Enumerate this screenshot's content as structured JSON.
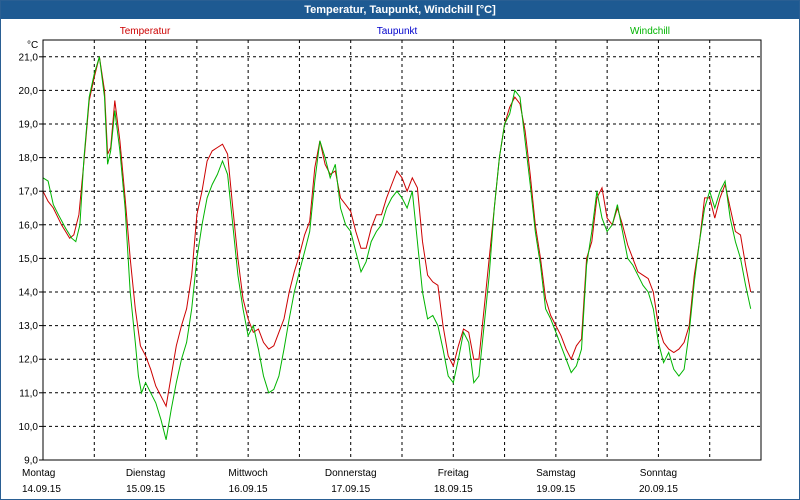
{
  "title": "Temperatur, Taupunkt, Windchill [°C]",
  "chart_data": {
    "type": "line",
    "ylabel": "°C",
    "ylim": [
      9.0,
      21.5
    ],
    "yticks": [
      "21,0",
      "20,0",
      "19,0",
      "18,0",
      "17,0",
      "16,0",
      "15,0",
      "14,0",
      "13,0",
      "12,0",
      "11,0",
      "10,0",
      "9,0"
    ],
    "ytick_values": [
      21,
      20,
      19,
      18,
      17,
      16,
      15,
      14,
      13,
      12,
      11,
      10,
      9
    ],
    "xlim": [
      0,
      7
    ],
    "grid": true,
    "days": [
      {
        "day": "Montag",
        "date": "14.09.15"
      },
      {
        "day": "Dienstag",
        "date": "15.09.15"
      },
      {
        "day": "Mittwoch",
        "date": "16.09.15"
      },
      {
        "day": "Donnerstag",
        "date": "17.09.15"
      },
      {
        "day": "Freitag",
        "date": "18.09.15"
      },
      {
        "day": "Samstag",
        "date": "19.09.15"
      },
      {
        "day": "Sonntag",
        "date": "20.09.15"
      }
    ],
    "legend": [
      {
        "name": "Temperatur",
        "color": "#cc0000"
      },
      {
        "name": "Taupunkt",
        "color": "#0000cc"
      },
      {
        "name": "Windchill",
        "color": "#00b400"
      }
    ],
    "series": [
      {
        "name": "Temperatur",
        "color": "#cc0000",
        "points": [
          [
            0.0,
            17.0
          ],
          [
            0.05,
            16.7
          ],
          [
            0.1,
            16.5
          ],
          [
            0.18,
            16.0
          ],
          [
            0.26,
            15.6
          ],
          [
            0.3,
            15.7
          ],
          [
            0.35,
            16.3
          ],
          [
            0.4,
            17.9
          ],
          [
            0.45,
            19.7
          ],
          [
            0.5,
            20.4
          ],
          [
            0.55,
            21.0
          ],
          [
            0.6,
            20.0
          ],
          [
            0.63,
            18.1
          ],
          [
            0.66,
            18.3
          ],
          [
            0.7,
            19.7
          ],
          [
            0.75,
            18.5
          ],
          [
            0.8,
            16.8
          ],
          [
            0.85,
            15.0
          ],
          [
            0.9,
            13.5
          ],
          [
            0.95,
            12.4
          ],
          [
            1.0,
            12.1
          ],
          [
            1.05,
            11.7
          ],
          [
            1.1,
            11.2
          ],
          [
            1.15,
            10.9
          ],
          [
            1.2,
            10.6
          ],
          [
            1.25,
            11.5
          ],
          [
            1.3,
            12.4
          ],
          [
            1.35,
            13.0
          ],
          [
            1.4,
            13.5
          ],
          [
            1.45,
            14.5
          ],
          [
            1.5,
            16.3
          ],
          [
            1.55,
            17.0
          ],
          [
            1.6,
            17.9
          ],
          [
            1.65,
            18.2
          ],
          [
            1.7,
            18.3
          ],
          [
            1.75,
            18.4
          ],
          [
            1.8,
            18.1
          ],
          [
            1.85,
            16.5
          ],
          [
            1.9,
            15.0
          ],
          [
            1.95,
            13.8
          ],
          [
            2.0,
            13.2
          ],
          [
            2.05,
            12.8
          ],
          [
            2.1,
            12.9
          ],
          [
            2.15,
            12.5
          ],
          [
            2.2,
            12.3
          ],
          [
            2.25,
            12.4
          ],
          [
            2.3,
            12.8
          ],
          [
            2.35,
            13.2
          ],
          [
            2.4,
            14.0
          ],
          [
            2.45,
            14.6
          ],
          [
            2.5,
            15.1
          ],
          [
            2.55,
            15.7
          ],
          [
            2.6,
            16.1
          ],
          [
            2.65,
            17.7
          ],
          [
            2.7,
            18.5
          ],
          [
            2.75,
            17.8
          ],
          [
            2.8,
            17.5
          ],
          [
            2.85,
            17.6
          ],
          [
            2.9,
            16.8
          ],
          [
            2.95,
            16.6
          ],
          [
            3.0,
            16.4
          ],
          [
            3.05,
            15.8
          ],
          [
            3.1,
            15.3
          ],
          [
            3.15,
            15.3
          ],
          [
            3.2,
            15.9
          ],
          [
            3.25,
            16.3
          ],
          [
            3.3,
            16.3
          ],
          [
            3.35,
            16.8
          ],
          [
            3.4,
            17.2
          ],
          [
            3.45,
            17.6
          ],
          [
            3.5,
            17.4
          ],
          [
            3.55,
            17.0
          ],
          [
            3.6,
            17.4
          ],
          [
            3.65,
            17.1
          ],
          [
            3.7,
            15.5
          ],
          [
            3.75,
            14.5
          ],
          [
            3.8,
            14.3
          ],
          [
            3.85,
            14.2
          ],
          [
            3.9,
            13.0
          ],
          [
            3.95,
            12.1
          ],
          [
            4.0,
            11.8
          ],
          [
            4.05,
            12.4
          ],
          [
            4.1,
            12.9
          ],
          [
            4.15,
            12.8
          ],
          [
            4.2,
            12.0
          ],
          [
            4.25,
            12.0
          ],
          [
            4.3,
            13.5
          ],
          [
            4.35,
            15.0
          ],
          [
            4.4,
            16.5
          ],
          [
            4.45,
            18.0
          ],
          [
            4.5,
            19.0
          ],
          [
            4.55,
            19.5
          ],
          [
            4.6,
            19.8
          ],
          [
            4.65,
            19.6
          ],
          [
            4.7,
            18.8
          ],
          [
            4.75,
            17.5
          ],
          [
            4.8,
            16.0
          ],
          [
            4.85,
            15.0
          ],
          [
            4.9,
            13.8
          ],
          [
            4.95,
            13.3
          ],
          [
            5.0,
            13.0
          ],
          [
            5.05,
            12.7
          ],
          [
            5.1,
            12.3
          ],
          [
            5.15,
            12.0
          ],
          [
            5.2,
            12.4
          ],
          [
            5.25,
            12.6
          ],
          [
            5.3,
            15.0
          ],
          [
            5.35,
            15.5
          ],
          [
            5.4,
            16.8
          ],
          [
            5.45,
            17.1
          ],
          [
            5.5,
            16.2
          ],
          [
            5.55,
            16.0
          ],
          [
            5.6,
            16.5
          ],
          [
            5.65,
            16.0
          ],
          [
            5.7,
            15.4
          ],
          [
            5.75,
            15.0
          ],
          [
            5.8,
            14.6
          ],
          [
            5.85,
            14.5
          ],
          [
            5.9,
            14.4
          ],
          [
            5.95,
            14.0
          ],
          [
            6.0,
            13.0
          ],
          [
            6.05,
            12.5
          ],
          [
            6.1,
            12.3
          ],
          [
            6.15,
            12.2
          ],
          [
            6.2,
            12.3
          ],
          [
            6.25,
            12.5
          ],
          [
            6.3,
            13.0
          ],
          [
            6.35,
            14.5
          ],
          [
            6.4,
            15.5
          ],
          [
            6.45,
            16.8
          ],
          [
            6.5,
            16.8
          ],
          [
            6.55,
            16.2
          ],
          [
            6.6,
            16.8
          ],
          [
            6.65,
            17.2
          ],
          [
            6.7,
            16.5
          ],
          [
            6.75,
            15.8
          ],
          [
            6.8,
            15.7
          ],
          [
            6.85,
            14.8
          ],
          [
            6.9,
            14.0
          ]
        ]
      },
      {
        "name": "Windchill",
        "color": "#00b400",
        "points": [
          [
            0.0,
            17.4
          ],
          [
            0.05,
            17.3
          ],
          [
            0.1,
            16.6
          ],
          [
            0.15,
            16.3
          ],
          [
            0.22,
            15.9
          ],
          [
            0.28,
            15.6
          ],
          [
            0.32,
            15.5
          ],
          [
            0.36,
            16.0
          ],
          [
            0.4,
            18.0
          ],
          [
            0.45,
            19.8
          ],
          [
            0.5,
            20.5
          ],
          [
            0.55,
            21.0
          ],
          [
            0.6,
            19.8
          ],
          [
            0.63,
            17.8
          ],
          [
            0.66,
            18.2
          ],
          [
            0.7,
            19.4
          ],
          [
            0.75,
            18.2
          ],
          [
            0.8,
            16.5
          ],
          [
            0.85,
            14.0
          ],
          [
            0.9,
            12.5
          ],
          [
            0.93,
            11.5
          ],
          [
            0.96,
            11.0
          ],
          [
            1.0,
            11.3
          ],
          [
            1.05,
            11.0
          ],
          [
            1.1,
            10.7
          ],
          [
            1.15,
            10.2
          ],
          [
            1.2,
            9.6
          ],
          [
            1.25,
            10.5
          ],
          [
            1.3,
            11.3
          ],
          [
            1.35,
            12.0
          ],
          [
            1.4,
            12.5
          ],
          [
            1.45,
            13.5
          ],
          [
            1.5,
            15.0
          ],
          [
            1.55,
            16.0
          ],
          [
            1.6,
            16.8
          ],
          [
            1.65,
            17.2
          ],
          [
            1.7,
            17.5
          ],
          [
            1.75,
            17.9
          ],
          [
            1.8,
            17.5
          ],
          [
            1.85,
            16.0
          ],
          [
            1.9,
            14.5
          ],
          [
            1.95,
            13.5
          ],
          [
            2.0,
            12.7
          ],
          [
            2.05,
            13.0
          ],
          [
            2.1,
            12.3
          ],
          [
            2.15,
            11.5
          ],
          [
            2.2,
            11.0
          ],
          [
            2.25,
            11.1
          ],
          [
            2.3,
            11.5
          ],
          [
            2.35,
            12.3
          ],
          [
            2.4,
            13.2
          ],
          [
            2.45,
            14.0
          ],
          [
            2.5,
            14.6
          ],
          [
            2.55,
            15.2
          ],
          [
            2.6,
            15.8
          ],
          [
            2.65,
            17.3
          ],
          [
            2.7,
            18.5
          ],
          [
            2.75,
            18.0
          ],
          [
            2.8,
            17.4
          ],
          [
            2.85,
            17.8
          ],
          [
            2.9,
            16.5
          ],
          [
            2.95,
            16.0
          ],
          [
            3.0,
            15.8
          ],
          [
            3.05,
            15.2
          ],
          [
            3.1,
            14.6
          ],
          [
            3.15,
            14.9
          ],
          [
            3.2,
            15.5
          ],
          [
            3.25,
            15.8
          ],
          [
            3.3,
            16.0
          ],
          [
            3.35,
            16.5
          ],
          [
            3.4,
            16.8
          ],
          [
            3.45,
            17.0
          ],
          [
            3.5,
            16.8
          ],
          [
            3.55,
            16.5
          ],
          [
            3.6,
            17.0
          ],
          [
            3.65,
            15.5
          ],
          [
            3.7,
            14.0
          ],
          [
            3.75,
            13.2
          ],
          [
            3.8,
            13.3
          ],
          [
            3.85,
            13.0
          ],
          [
            3.9,
            12.3
          ],
          [
            3.95,
            11.5
          ],
          [
            4.0,
            11.3
          ],
          [
            4.05,
            12.0
          ],
          [
            4.1,
            12.8
          ],
          [
            4.15,
            12.5
          ],
          [
            4.2,
            11.3
          ],
          [
            4.25,
            11.5
          ],
          [
            4.3,
            13.0
          ],
          [
            4.35,
            14.5
          ],
          [
            4.4,
            16.5
          ],
          [
            4.45,
            18.0
          ],
          [
            4.5,
            19.0
          ],
          [
            4.55,
            19.3
          ],
          [
            4.6,
            20.0
          ],
          [
            4.65,
            19.8
          ],
          [
            4.7,
            18.5
          ],
          [
            4.75,
            17.2
          ],
          [
            4.8,
            15.8
          ],
          [
            4.85,
            14.8
          ],
          [
            4.9,
            13.5
          ],
          [
            4.95,
            13.2
          ],
          [
            5.0,
            12.8
          ],
          [
            5.05,
            12.4
          ],
          [
            5.1,
            12.0
          ],
          [
            5.15,
            11.6
          ],
          [
            5.2,
            11.8
          ],
          [
            5.25,
            12.3
          ],
          [
            5.3,
            14.8
          ],
          [
            5.35,
            15.8
          ],
          [
            5.4,
            17.0
          ],
          [
            5.45,
            16.2
          ],
          [
            5.5,
            15.8
          ],
          [
            5.55,
            16.0
          ],
          [
            5.6,
            16.6
          ],
          [
            5.65,
            15.8
          ],
          [
            5.7,
            15.0
          ],
          [
            5.75,
            14.8
          ],
          [
            5.8,
            14.5
          ],
          [
            5.85,
            14.2
          ],
          [
            5.9,
            14.0
          ],
          [
            5.95,
            13.5
          ],
          [
            6.0,
            12.5
          ],
          [
            6.05,
            11.9
          ],
          [
            6.1,
            12.2
          ],
          [
            6.15,
            11.7
          ],
          [
            6.2,
            11.5
          ],
          [
            6.25,
            11.7
          ],
          [
            6.3,
            12.8
          ],
          [
            6.35,
            14.3
          ],
          [
            6.4,
            15.5
          ],
          [
            6.45,
            16.5
          ],
          [
            6.5,
            17.0
          ],
          [
            6.55,
            16.5
          ],
          [
            6.6,
            17.0
          ],
          [
            6.65,
            17.3
          ],
          [
            6.7,
            16.2
          ],
          [
            6.75,
            15.5
          ],
          [
            6.8,
            15.0
          ],
          [
            6.85,
            14.2
          ],
          [
            6.9,
            13.5
          ]
        ]
      }
    ]
  }
}
